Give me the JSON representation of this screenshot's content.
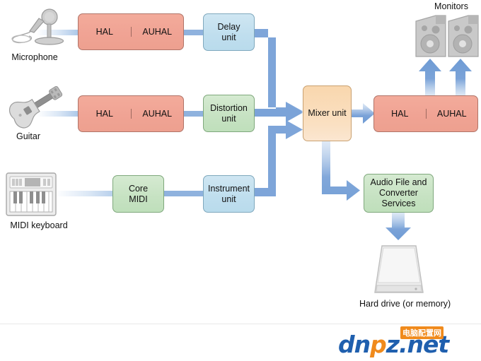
{
  "diagram": {
    "title": "Core Audio signal flow diagram",
    "colors": {
      "red_node": "#f0a394",
      "blue_node": "#bfdeee",
      "green_node": "#c6e2c2",
      "orange_node": "#f9d7ae",
      "arrow": "#7ba3d8",
      "device_gray": "#c8c8c8",
      "watermark_blue": "#1f5fae",
      "watermark_orange": "#f08a1c"
    },
    "devices": {
      "microphone": {
        "label": "Microphone",
        "icon": "microphone-icon"
      },
      "guitar": {
        "label": "Guitar",
        "icon": "guitar-icon"
      },
      "midi_keyboard": {
        "label": "MIDI keyboard",
        "icon": "midi-keyboard-icon"
      },
      "monitors": {
        "label": "Monitors",
        "icon": "studio-monitors-icon"
      },
      "hard_drive": {
        "label_line1": "Hard drive",
        "label_line2": "(or memory)",
        "icon": "hard-drive-icon"
      }
    },
    "nodes": {
      "hal_auhal_mic": {
        "left": "HAL",
        "right": "AUHAL"
      },
      "hal_auhal_guitar": {
        "left": "HAL",
        "right": "AUHAL"
      },
      "hal_auhal_out": {
        "left": "HAL",
        "right": "AUHAL"
      },
      "delay_unit": {
        "line1": "Delay",
        "line2": "unit"
      },
      "distortion_unit": {
        "line1": "Distortion",
        "line2": "unit"
      },
      "core_midi": {
        "line1": "Core",
        "line2": "MIDI"
      },
      "instrument_unit": {
        "line1": "Instrument",
        "line2": "unit"
      },
      "mixer_unit": {
        "line1": "Mixer unit"
      },
      "audio_file_services": {
        "line1": "Audio File and",
        "line2": "Converter",
        "line3": "Services"
      }
    },
    "watermark": {
      "brand_dn": "dn",
      "brand_p": "p",
      "brand_z": "z",
      "brand_net": ".net",
      "chinese": "电脑配置网"
    }
  }
}
